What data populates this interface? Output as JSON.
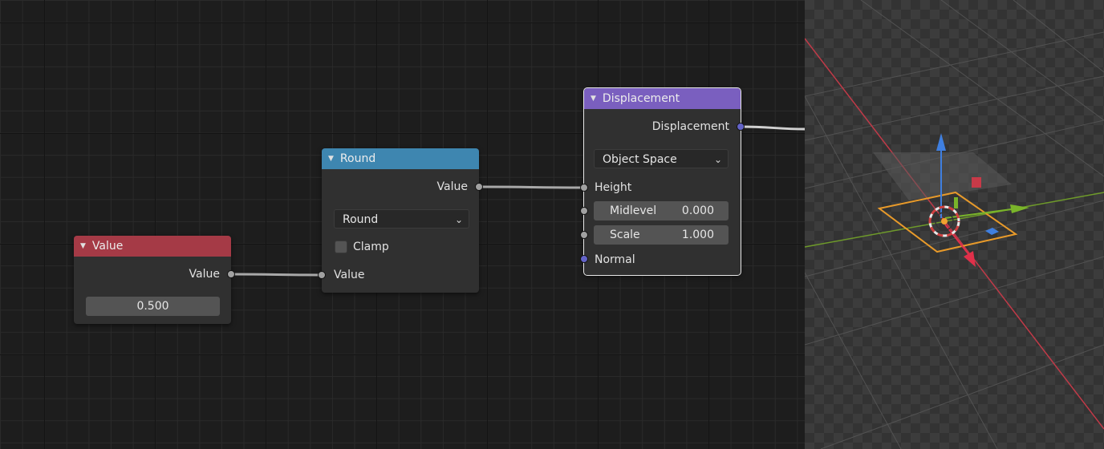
{
  "colors": {
    "value_header": "#a53a46",
    "round_header": "#3e86b0",
    "displacement_header": "#7a5fbf",
    "socket_float": "#a1a1a1",
    "socket_vector": "#6363c7"
  },
  "nodes": {
    "value": {
      "title": "Value",
      "output_label": "Value",
      "field_value": "0.500"
    },
    "round": {
      "title": "Round",
      "output_label": "Value",
      "mode": "Round",
      "clamp_label": "Clamp",
      "clamp_checked": false,
      "input_label": "Value"
    },
    "displacement": {
      "title": "Displacement",
      "output_label": "Displacement",
      "space": "Object Space",
      "height_label": "Height",
      "midlevel_label": "Midlevel",
      "midlevel_value": "0.000",
      "scale_label": "Scale",
      "scale_value": "1.000",
      "normal_label": "Normal"
    }
  },
  "viewport": {
    "icons": [
      "empty-arrows-gizmo",
      "plane-object",
      "3d-cursor-icon"
    ]
  }
}
